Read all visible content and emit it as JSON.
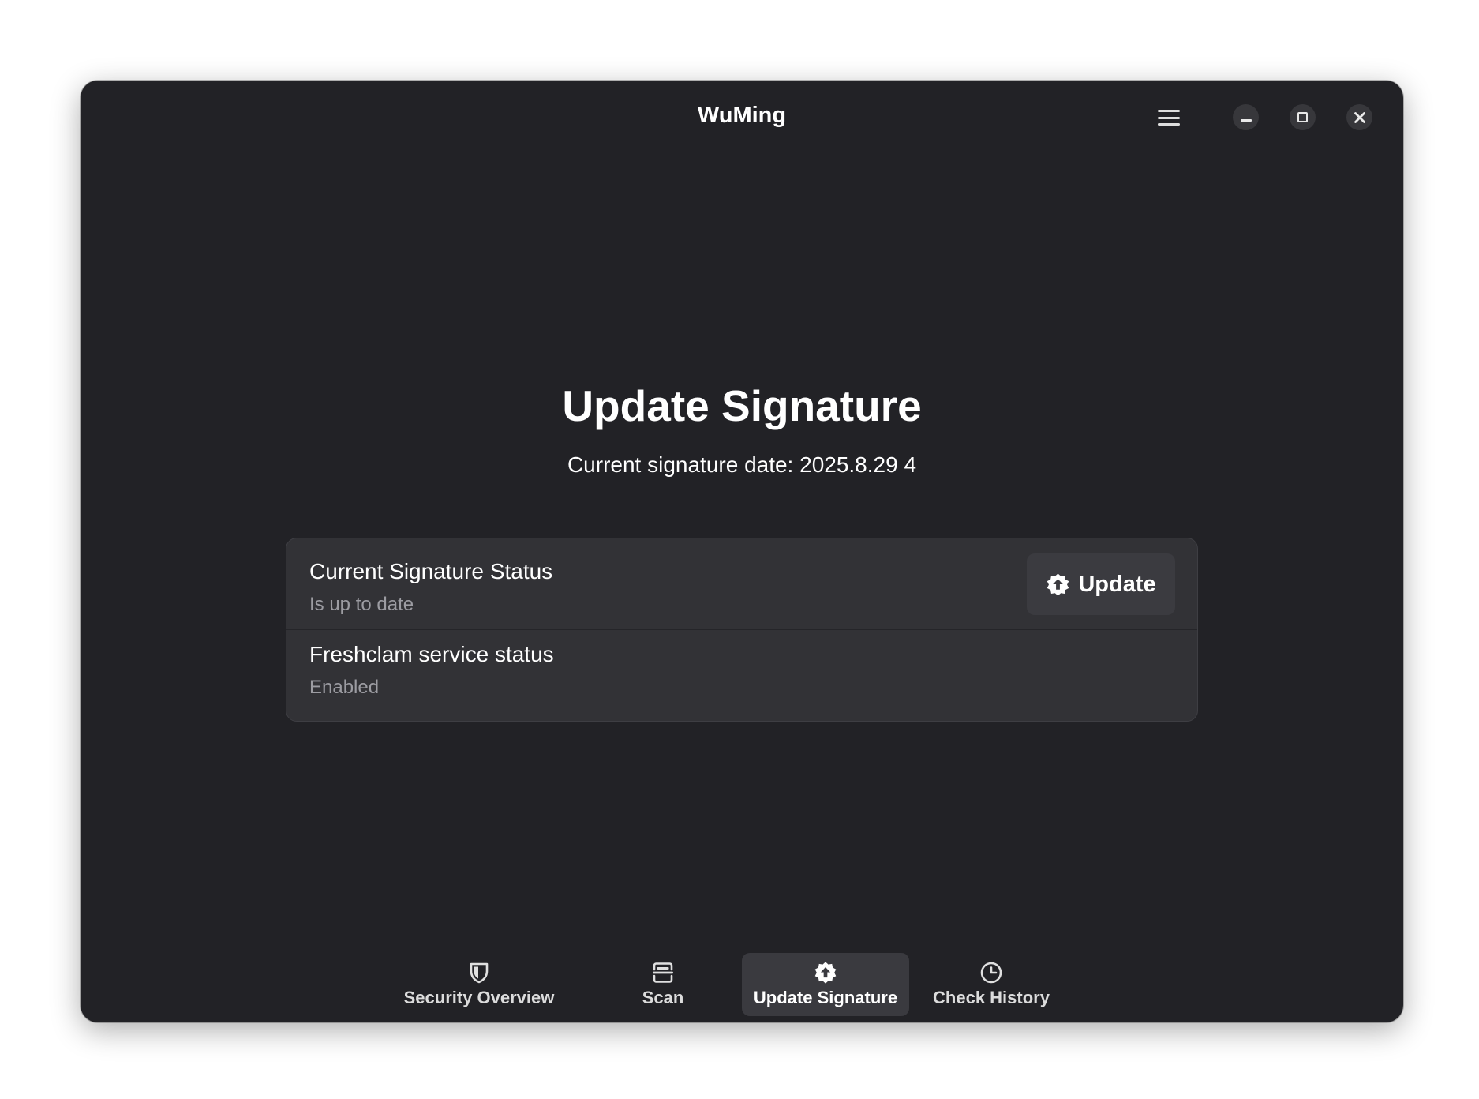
{
  "window": {
    "title": "WuMing",
    "controls": {
      "menu_icon": "hamburger-menu-icon",
      "minimize_icon": "minimize-icon",
      "maximize_icon": "maximize-icon",
      "close_icon": "close-icon"
    }
  },
  "page": {
    "title": "Update Signature",
    "subtitle": "Current signature date: 2025.8.29 4"
  },
  "status_card": {
    "rows": [
      {
        "title": "Current Signature Status",
        "subtitle": "Is up to date"
      },
      {
        "title": "Freshclam service status",
        "subtitle": "Enabled"
      }
    ],
    "update_button": {
      "label": "Update",
      "icon": "update-gear-arrow-icon"
    }
  },
  "nav": {
    "tabs": [
      {
        "label": "Security Overview",
        "icon": "shield-icon",
        "active": false
      },
      {
        "label": "Scan",
        "icon": "scan-icon",
        "active": false
      },
      {
        "label": "Update Signature",
        "icon": "update-gear-arrow-icon",
        "active": true
      },
      {
        "label": "Check History",
        "icon": "clock-icon",
        "active": false
      }
    ]
  },
  "colors": {
    "window_bg": "#222226",
    "card_bg": "#323236",
    "button_bg": "#3b3b40",
    "active_tab_bg": "#3a3a3f",
    "text_primary": "#ffffff",
    "text_secondary": "#9c9ca2"
  }
}
